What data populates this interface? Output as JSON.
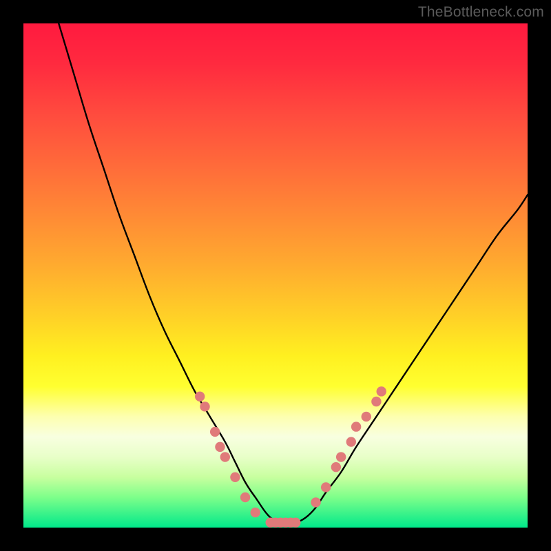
{
  "watermark": "TheBottleneck.com",
  "colors": {
    "curve_stroke": "#000000",
    "marker_fill": "#e07a7a",
    "marker_stroke": "#c96060",
    "frame_bg": "#000000"
  },
  "chart_data": {
    "type": "line",
    "title": "",
    "xlabel": "",
    "ylabel": "",
    "xlim": [
      0,
      100
    ],
    "ylim": [
      0,
      100
    ],
    "grid": false,
    "legend": false,
    "series": [
      {
        "name": "curve",
        "x": [
          7,
          10,
          13,
          16,
          19,
          22,
          25,
          28,
          31,
          34,
          37,
          40,
          42,
          44,
          46,
          49,
          52,
          54,
          56,
          58,
          60,
          63,
          66,
          70,
          74,
          78,
          82,
          86,
          90,
          94,
          98,
          100
        ],
        "y": [
          100,
          90,
          80,
          71,
          62,
          54,
          46,
          39,
          33,
          27,
          22,
          17,
          13,
          9,
          6,
          2,
          1,
          1,
          2,
          4,
          7,
          11,
          16,
          22,
          28,
          34,
          40,
          46,
          52,
          58,
          63,
          66
        ]
      }
    ],
    "markers": [
      {
        "x": 35,
        "y": 26
      },
      {
        "x": 36,
        "y": 24
      },
      {
        "x": 38,
        "y": 19
      },
      {
        "x": 39,
        "y": 16
      },
      {
        "x": 40,
        "y": 14
      },
      {
        "x": 42,
        "y": 10
      },
      {
        "x": 44,
        "y": 6
      },
      {
        "x": 46,
        "y": 3
      },
      {
        "x": 49,
        "y": 1
      },
      {
        "x": 50,
        "y": 1
      },
      {
        "x": 51,
        "y": 1
      },
      {
        "x": 52,
        "y": 1
      },
      {
        "x": 53,
        "y": 1
      },
      {
        "x": 54,
        "y": 1
      },
      {
        "x": 58,
        "y": 5
      },
      {
        "x": 60,
        "y": 8
      },
      {
        "x": 62,
        "y": 12
      },
      {
        "x": 63,
        "y": 14
      },
      {
        "x": 65,
        "y": 17
      },
      {
        "x": 66,
        "y": 20
      },
      {
        "x": 68,
        "y": 22
      },
      {
        "x": 70,
        "y": 25
      },
      {
        "x": 71,
        "y": 27
      }
    ]
  }
}
